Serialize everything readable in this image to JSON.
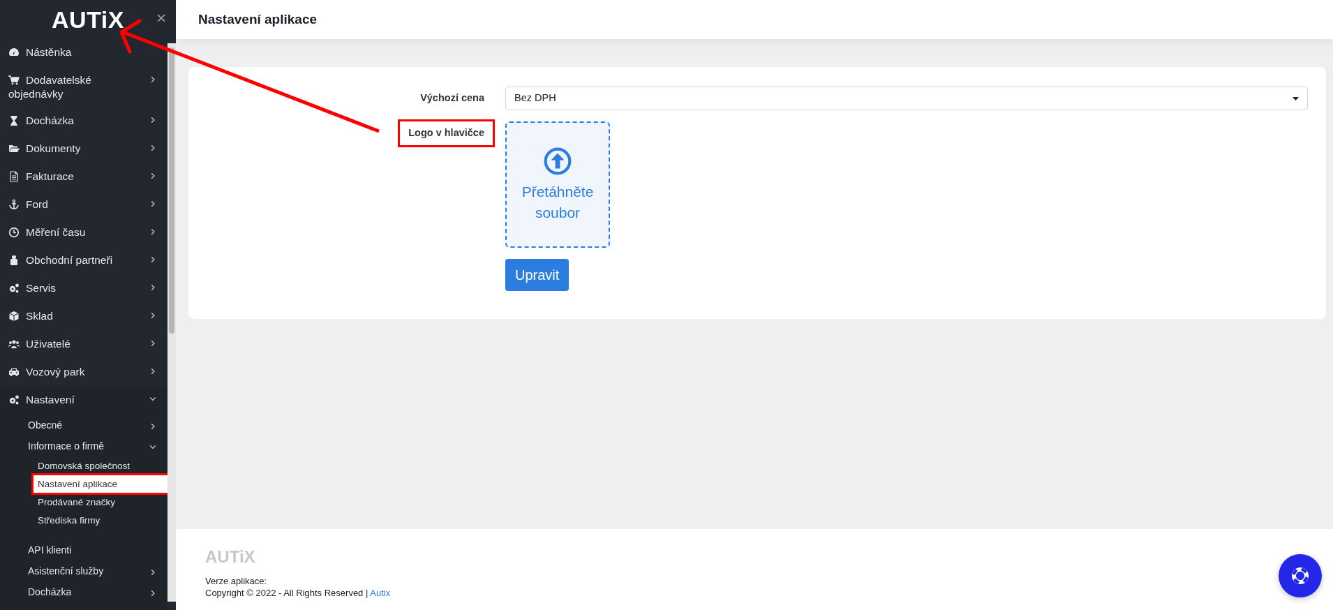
{
  "sidebar": {
    "logo": "AUTiX",
    "close": "×",
    "items": [
      {
        "label": "Nástěnka",
        "has_children": false,
        "expanded": false
      },
      {
        "label": "Dodavatelské objednávky",
        "has_children": true,
        "expanded": false
      },
      {
        "label": "Docházka",
        "has_children": true,
        "expanded": false
      },
      {
        "label": "Dokumenty",
        "has_children": true,
        "expanded": false
      },
      {
        "label": "Fakturace",
        "has_children": true,
        "expanded": false
      },
      {
        "label": "Ford",
        "has_children": true,
        "expanded": false
      },
      {
        "label": "Měření času",
        "has_children": true,
        "expanded": false
      },
      {
        "label": "Obchodní partneři",
        "has_children": true,
        "expanded": false
      },
      {
        "label": "Servis",
        "has_children": true,
        "expanded": false
      },
      {
        "label": "Sklad",
        "has_children": true,
        "expanded": false
      },
      {
        "label": "Uživatelé",
        "has_children": true,
        "expanded": false
      },
      {
        "label": "Vozový park",
        "has_children": true,
        "expanded": false
      },
      {
        "label": "Nastavení",
        "has_children": true,
        "expanded": true,
        "children": [
          {
            "label": "Obecné",
            "has_children": true,
            "expanded": false
          },
          {
            "label": "Informace o firmě",
            "has_children": true,
            "expanded": true,
            "children": [
              {
                "label": "Domovská společnost",
                "selected": false,
                "annotated": false
              },
              {
                "label": "Nastavení aplikace",
                "selected": true,
                "annotated": true
              },
              {
                "label": "Prodávané značky",
                "selected": false,
                "annotated": false
              },
              {
                "label": "Střediska firmy",
                "selected": false,
                "annotated": false
              }
            ]
          },
          {
            "label": "API klienti",
            "has_children": false,
            "expanded": false
          },
          {
            "label": "Asistenční služby",
            "has_children": true,
            "expanded": false
          },
          {
            "label": "Docházka",
            "has_children": true,
            "expanded": false
          }
        ]
      }
    ]
  },
  "page_title": "Nastavení aplikace",
  "form": {
    "fields": [
      {
        "kind": "select",
        "label": "Výchozí cena",
        "value": "Bez DPH",
        "annotated": false
      },
      {
        "kind": "dropzone",
        "label": "Logo v hlavičce",
        "text": "Přetáhněte soubor",
        "annotated": true
      }
    ],
    "submit": "Upravit"
  },
  "footer": {
    "logo": "AUTiX",
    "version_label": "Verze aplikace:",
    "copyright": "Copyright © 2022 - All Rights Reserved |",
    "link": "Autix"
  },
  "annotations": [
    {
      "kind": "arrow"
    }
  ]
}
